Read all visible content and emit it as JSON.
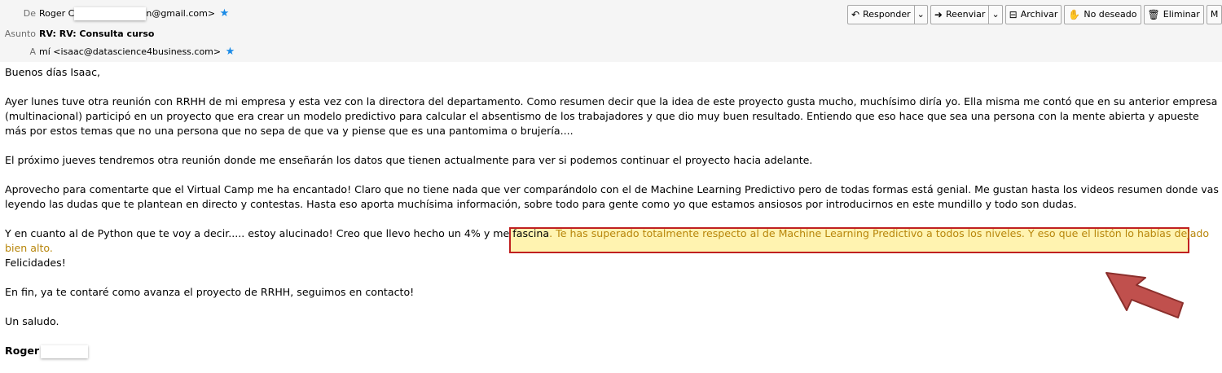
{
  "header": {
    "from_label": "De",
    "from_name": "Roger C",
    "from_email_suffix": "n@gmail.com>",
    "subject_label": "Asunto",
    "subject": "RV: RV: Consulta curso",
    "to_label": "A",
    "to_value": "mí <isaac@datascience4business.com>"
  },
  "toolbar": {
    "reply": "Responder",
    "forward": "Reenviar",
    "archive": "Archivar",
    "junk": "No deseado",
    "delete": "Eliminar",
    "more": "M"
  },
  "body": {
    "greeting": "Buenos días Isaac,",
    "p1": "Ayer lunes tuve otra reunión con RRHH de mi empresa y esta vez con la directora del departamento. Como resumen decir que la idea de este proyecto gusta mucho, muchísimo diría yo. Ella misma me contó que en su anterior empresa (multinacional) participó en un proyecto que era crear un modelo predictivo para calcular el absentismo de los trabajadores y que dio muy buen resultado. Entiendo que eso hace que sea una persona con la mente abierta y apueste más por estos temas que no una persona que no sepa de que va y piense que es una pantomima o brujería....",
    "p2": "El próximo jueves tendremos otra reunión donde me enseñarán los datos que tienen actualmente para ver si podemos continuar el proyecto hacia adelante.",
    "p3": "Aprovecho para comentarte que el Virtual Camp me ha encantado! Claro que no tiene nada que ver comparándolo con el de Machine Learning Predictivo pero de todas formas está genial. Me gustan hasta los videos resumen donde vas leyendo las dudas que te plantean en directo y contestas. Hasta eso aporta muchísima información, sobre todo para gente como yo que estamos ansiosos por introducirnos en este mundillo y todo son dudas.",
    "p4_start": "Y en cuanto al de Python que te voy a decir..... estoy alucinado! Creo que llevo hecho un 4% y me fascina",
    "p4_highlight": ". Te has superado totalmente respecto al de Machine Learning Predictivo a todos los niveles. Y eso que el listón lo habías dejado bien alto.",
    "p4_end": "Felicidades!",
    "p5": "En fin, ya te contaré como avanza el proyecto de RRHH, seguimos en contacto!",
    "closing": "Un saludo.",
    "signature": "Roger"
  },
  "colors": {
    "highlight_bg": "#fff3b0",
    "highlight_border": "#c02020",
    "arrow": "#c0504d",
    "star": "#1a8ae6"
  }
}
